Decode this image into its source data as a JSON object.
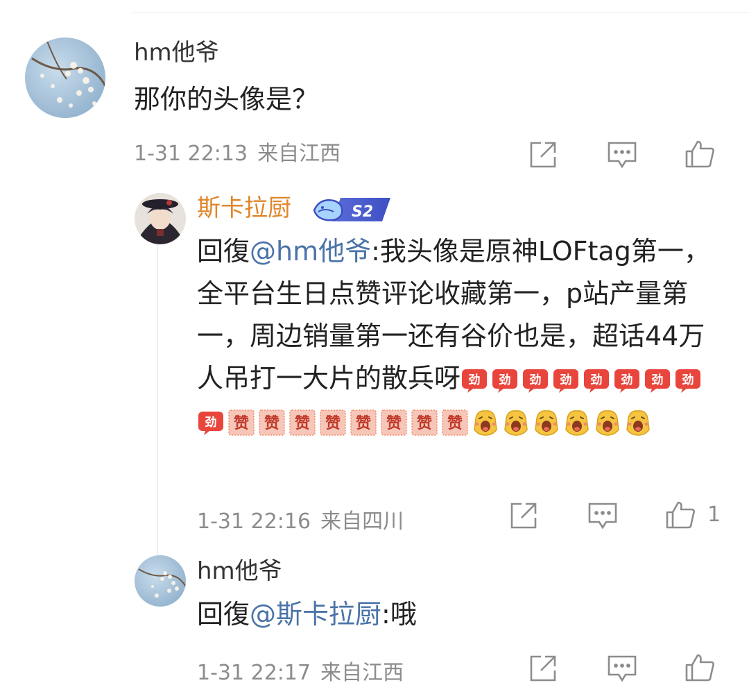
{
  "comments": [
    {
      "user": "hm他爷",
      "text": "那你的头像是？",
      "time": "1-31 22:13",
      "location": "来自江西"
    },
    {
      "user": "斯卡拉厨",
      "badge": "S2",
      "reply_prefix": "回復",
      "mention": "@hm他爷",
      "text": ":我头像是原神LOFtag第一，全平台生日点赞评论收藏第一，p站产量第一，周边销量第一还有谷价也是，超话44万人吊打一大片的散兵呀",
      "emoji": {
        "jin": {
          "label": "劲",
          "count": 9,
          "icon": "jin-sticker-icon"
        },
        "zan": {
          "label": "赞",
          "count": 8,
          "icon": "zan-sticker-icon"
        },
        "laugh": {
          "count": 6,
          "icon": "laughing-face-icon"
        }
      },
      "time": "1-31 22:16",
      "location": "来自四川",
      "likes": "1"
    },
    {
      "user": "hm他爷",
      "reply_prefix": "回復",
      "mention": "@斯卡拉厨",
      "text": ":哦",
      "time": "1-31 22:17",
      "location": "来自江西"
    }
  ],
  "icons": {
    "repost": "share-icon",
    "comment": "comment-icon",
    "like": "thumbs-up-icon"
  },
  "colors": {
    "mention": "#4a73a8",
    "vip_name": "#e0862a",
    "meta": "#8c8c8c"
  }
}
